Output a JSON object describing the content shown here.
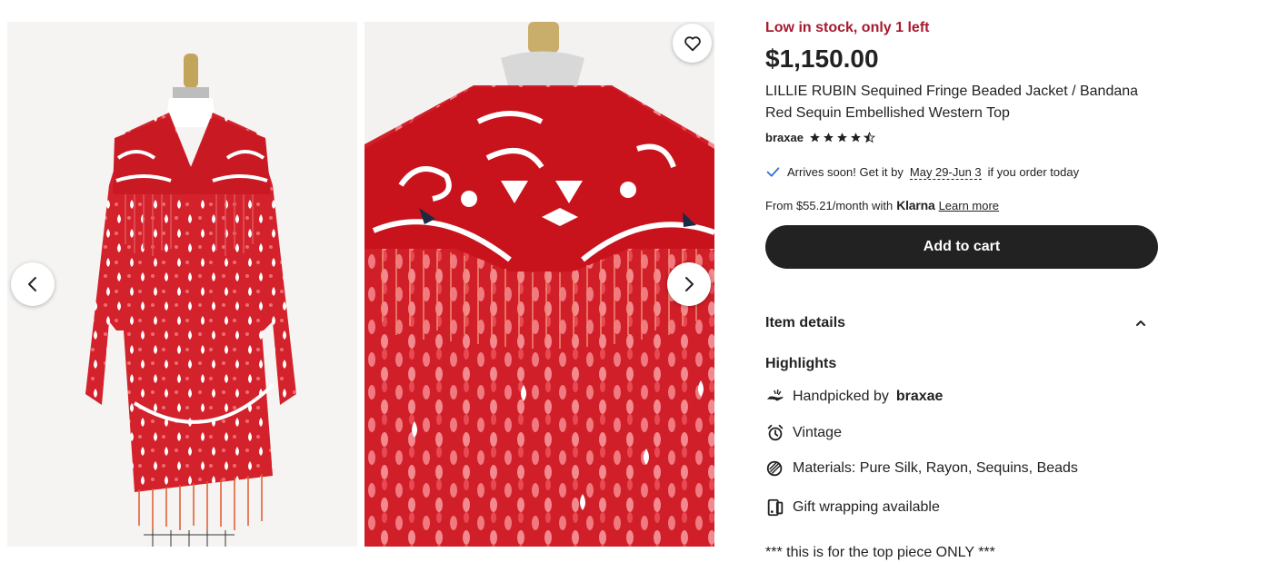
{
  "listing": {
    "stock_text": "Low in stock, only 1 left",
    "price": "$1,150.00",
    "title": "LILLIE RUBIN Sequined Fringe Beaded Jacket / Bandana Red Sequin Embellished Western Top",
    "shop_name": "braxae",
    "rating": 4.5
  },
  "shipping": {
    "prefix": "Arrives soon! Get it by",
    "dates": "May 29-Jun 3",
    "suffix": "if you order today"
  },
  "klarna": {
    "prefix": "From $55.21/month with",
    "brand": "Klarna",
    "learn_more": "Learn more"
  },
  "actions": {
    "add_to_cart": "Add to cart"
  },
  "details": {
    "header": "Item details",
    "highlights_title": "Highlights",
    "handpicked_prefix": "Handpicked by",
    "handpicked_shop": "braxae",
    "vintage": "Vintage",
    "materials": "Materials: Pure Silk, Rayon, Sequins, Beads",
    "gift": "Gift wrapping available",
    "note": "*** this is for the top piece ONLY ***"
  },
  "colors": {
    "stock_red": "#a61a2e",
    "button_dark": "#222222",
    "check_blue": "#2f6dd0",
    "sequin_red": "#d2202a"
  },
  "icons": [
    "chevron-left-icon",
    "chevron-right-icon",
    "heart-icon",
    "star-icon",
    "check-icon",
    "chevron-up-icon",
    "hand-icon",
    "clock-icon",
    "materials-icon",
    "gift-icon"
  ]
}
